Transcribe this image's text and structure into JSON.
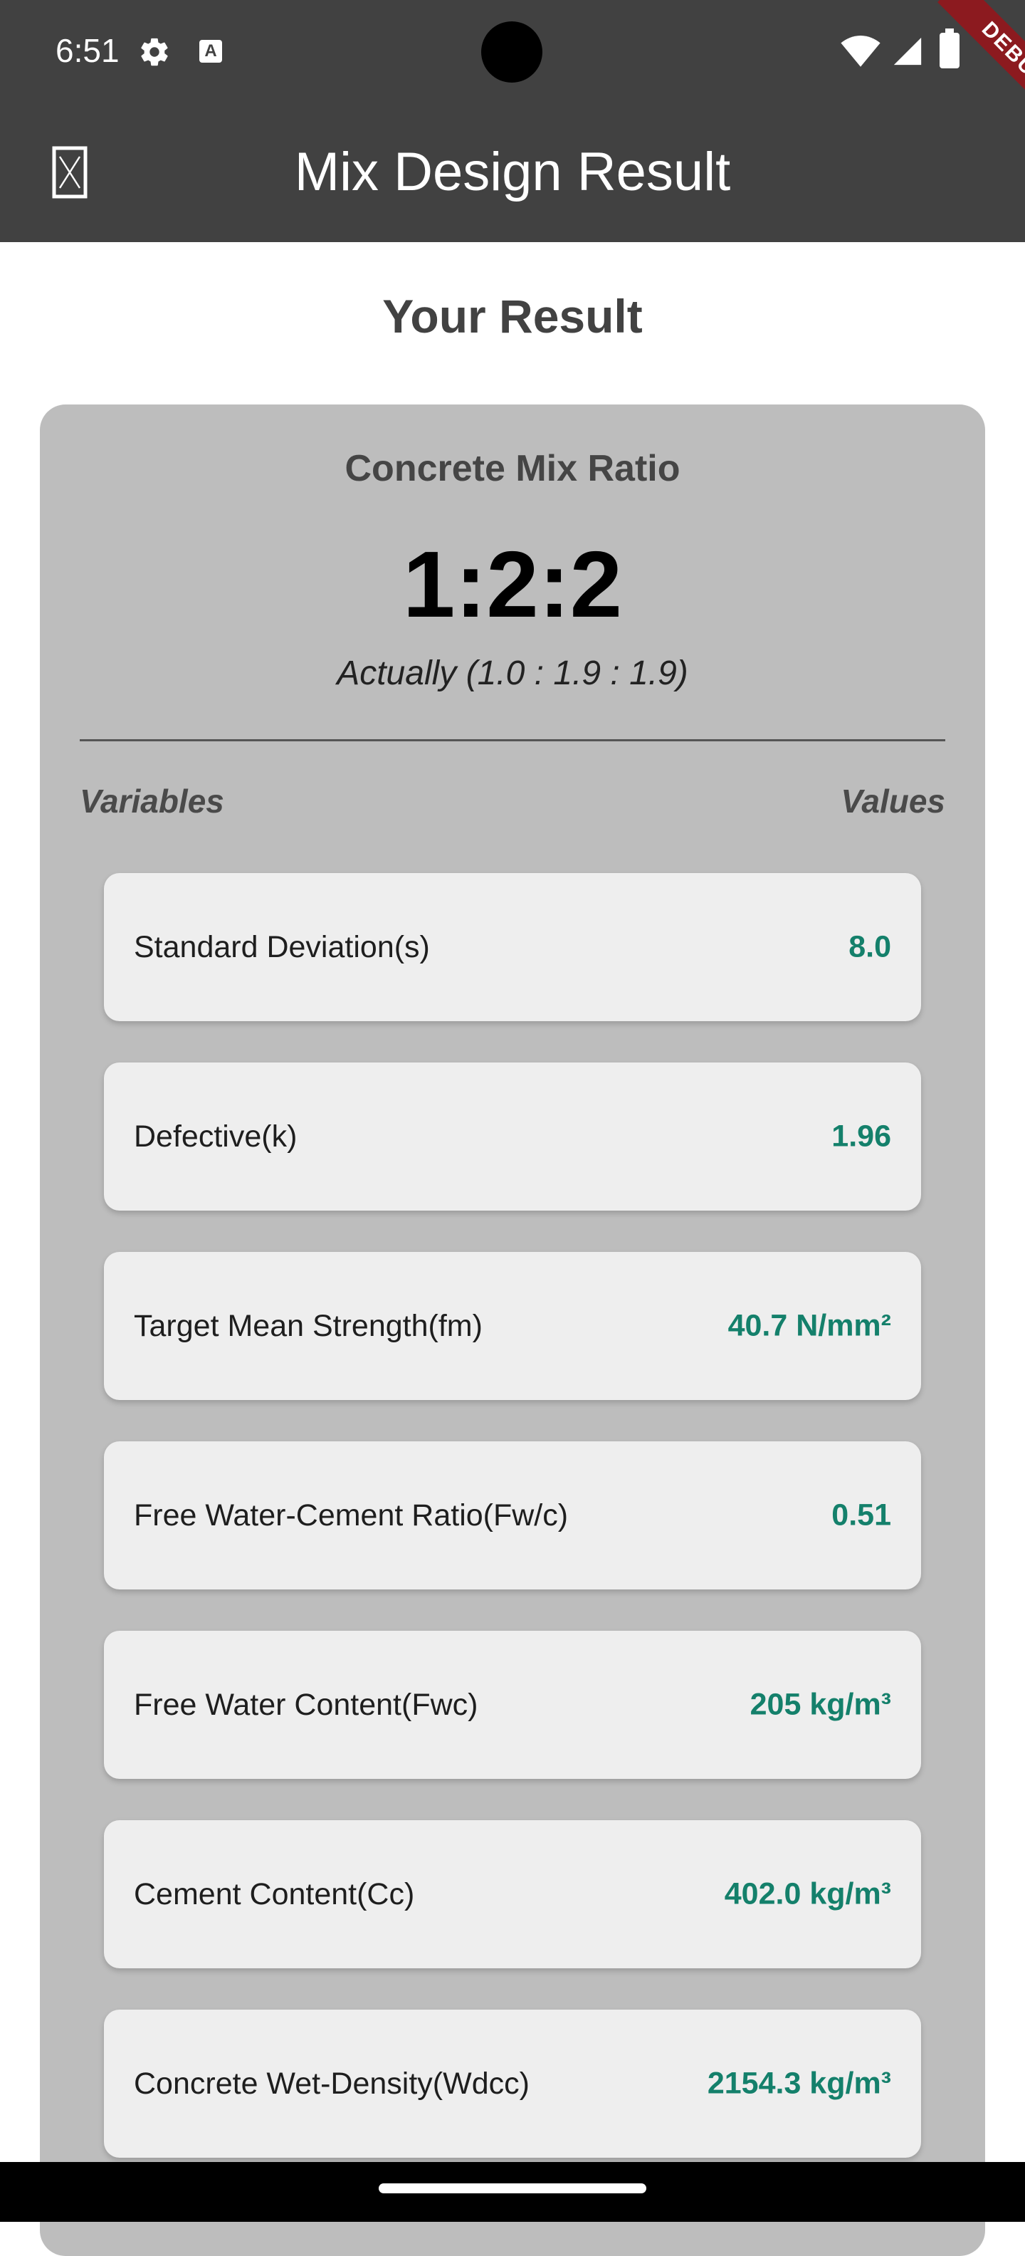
{
  "status_bar": {
    "time": "6:51",
    "debug_label": "DEBUG"
  },
  "app_bar": {
    "title": "Mix Design Result",
    "menu_icon": "menu-icon"
  },
  "page": {
    "title": "Your Result"
  },
  "mix_ratio": {
    "heading": "Concrete Mix Ratio",
    "value": "1:2:2",
    "actual": "Actually (1.0 : 1.9 : 1.9)"
  },
  "table": {
    "header_variables": "Variables",
    "header_values": "Values",
    "rows": [
      {
        "label": "Standard Deviation(s)",
        "value": "8.0"
      },
      {
        "label": "Defective(k)",
        "value": "1.96"
      },
      {
        "label": "Target Mean Strength(fm)",
        "value": "40.7 N/mm²"
      },
      {
        "label": "Free Water-Cement Ratio(Fw/c)",
        "value": "0.51"
      },
      {
        "label": "Free Water Content(Fwc)",
        "value": "205 kg/m³"
      },
      {
        "label": "Cement Content(Cc)",
        "value": "402.0 kg/m³"
      },
      {
        "label": "Concrete Wet-Density(Wdcc)",
        "value": "2154.3 kg/m³"
      }
    ]
  },
  "colors": {
    "app_bar": "#414141",
    "panel": "#bdbdbd",
    "card": "#eeeeee",
    "value_text": "#14806b",
    "debug_banner": "#8c1a1f"
  }
}
